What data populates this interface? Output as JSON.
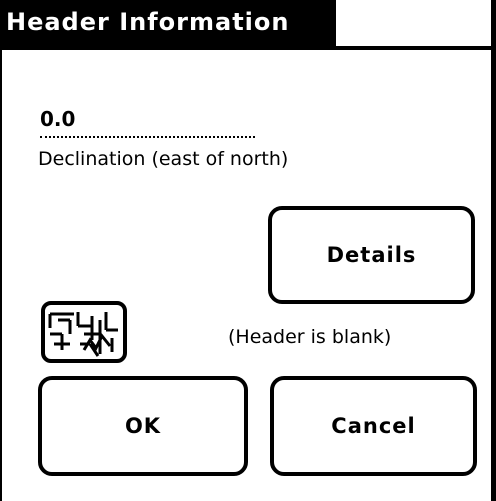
{
  "window": {
    "title": "Header Information"
  },
  "declination": {
    "value": "0.0",
    "label": "Declination (east of north)"
  },
  "buttons": {
    "details": "Details",
    "ok": "OK",
    "cancel": "Cancel"
  },
  "status": {
    "icon": "document-stamp-icon",
    "text": "(Header is blank)"
  },
  "colors": {
    "foreground": "#000000",
    "background": "#ffffff"
  }
}
